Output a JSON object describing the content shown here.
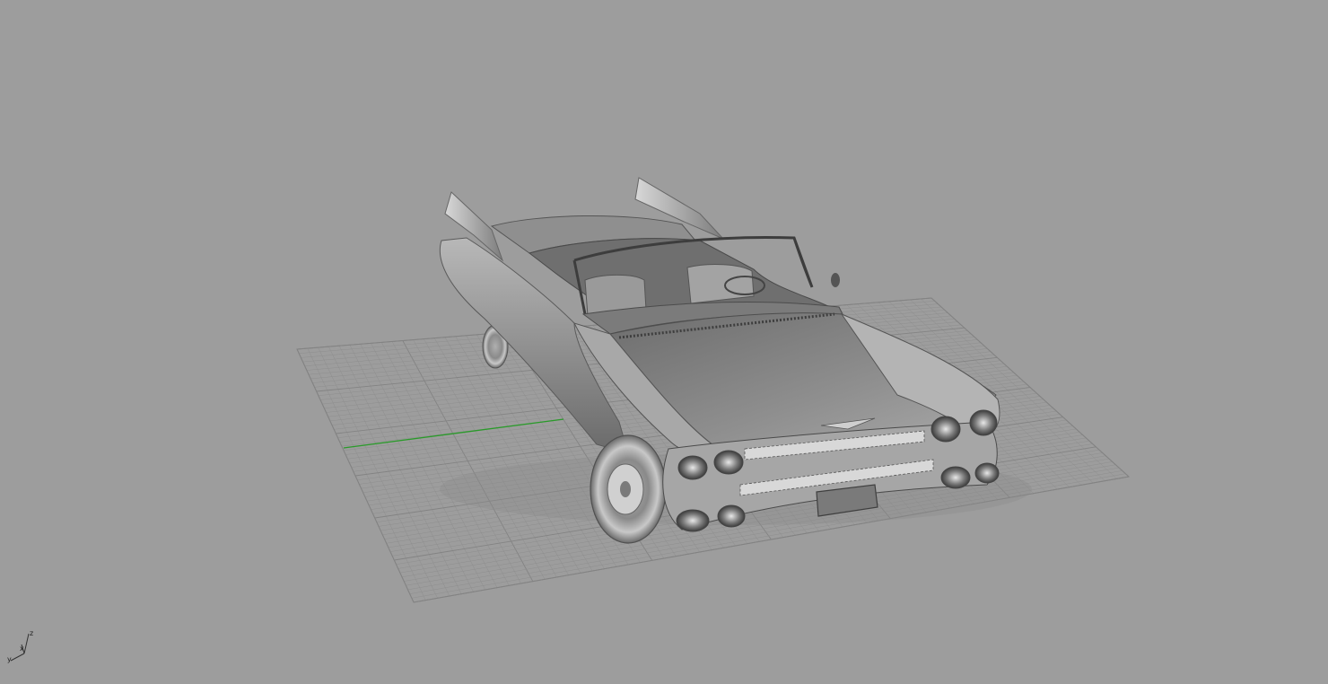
{
  "viewport": {
    "mode": "Shaded",
    "background_color": "#9d9d9d",
    "grid_color": "#8e8e8e",
    "grid_major_color": "#838383",
    "x_axis_color": "#2a9a2a",
    "object": "car-model"
  },
  "axes_widget": {
    "z_label": "z",
    "x_label": "x",
    "y_label": "y"
  }
}
